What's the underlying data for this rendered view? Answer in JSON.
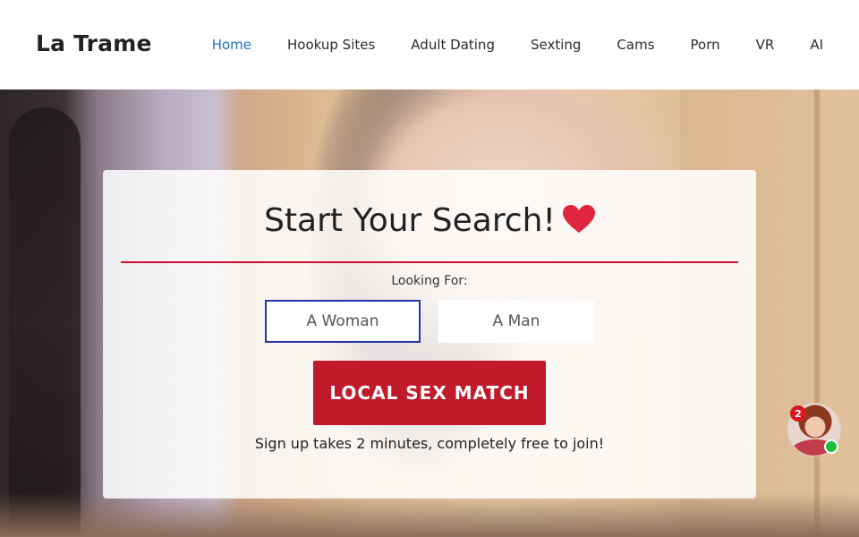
{
  "header": {
    "logo": "La Trame",
    "nav": [
      {
        "label": "Home",
        "active": true
      },
      {
        "label": "Hookup Sites",
        "active": false
      },
      {
        "label": "Adult Dating",
        "active": false
      },
      {
        "label": "Sexting",
        "active": false
      },
      {
        "label": "Cams",
        "active": false
      },
      {
        "label": "Porn",
        "active": false
      },
      {
        "label": "VR",
        "active": false
      },
      {
        "label": "AI",
        "active": false
      }
    ]
  },
  "search_card": {
    "title": "Start Your Search!",
    "title_icon": "heart-icon",
    "looking_for_label": "Looking For:",
    "options": [
      {
        "label": "A Woman",
        "selected": true
      },
      {
        "label": "A Man",
        "selected": false
      }
    ],
    "cta_label": "LOCAL SEX MATCH",
    "note": "Sign up takes 2 minutes, completely free to join!"
  },
  "chat_widget": {
    "badge_count": "2",
    "status": "online"
  },
  "colors": {
    "accent_red": "#c11a2b",
    "nav_active": "#1e73be",
    "selected_border": "#2233aa",
    "online_green": "#1fbd3a"
  }
}
